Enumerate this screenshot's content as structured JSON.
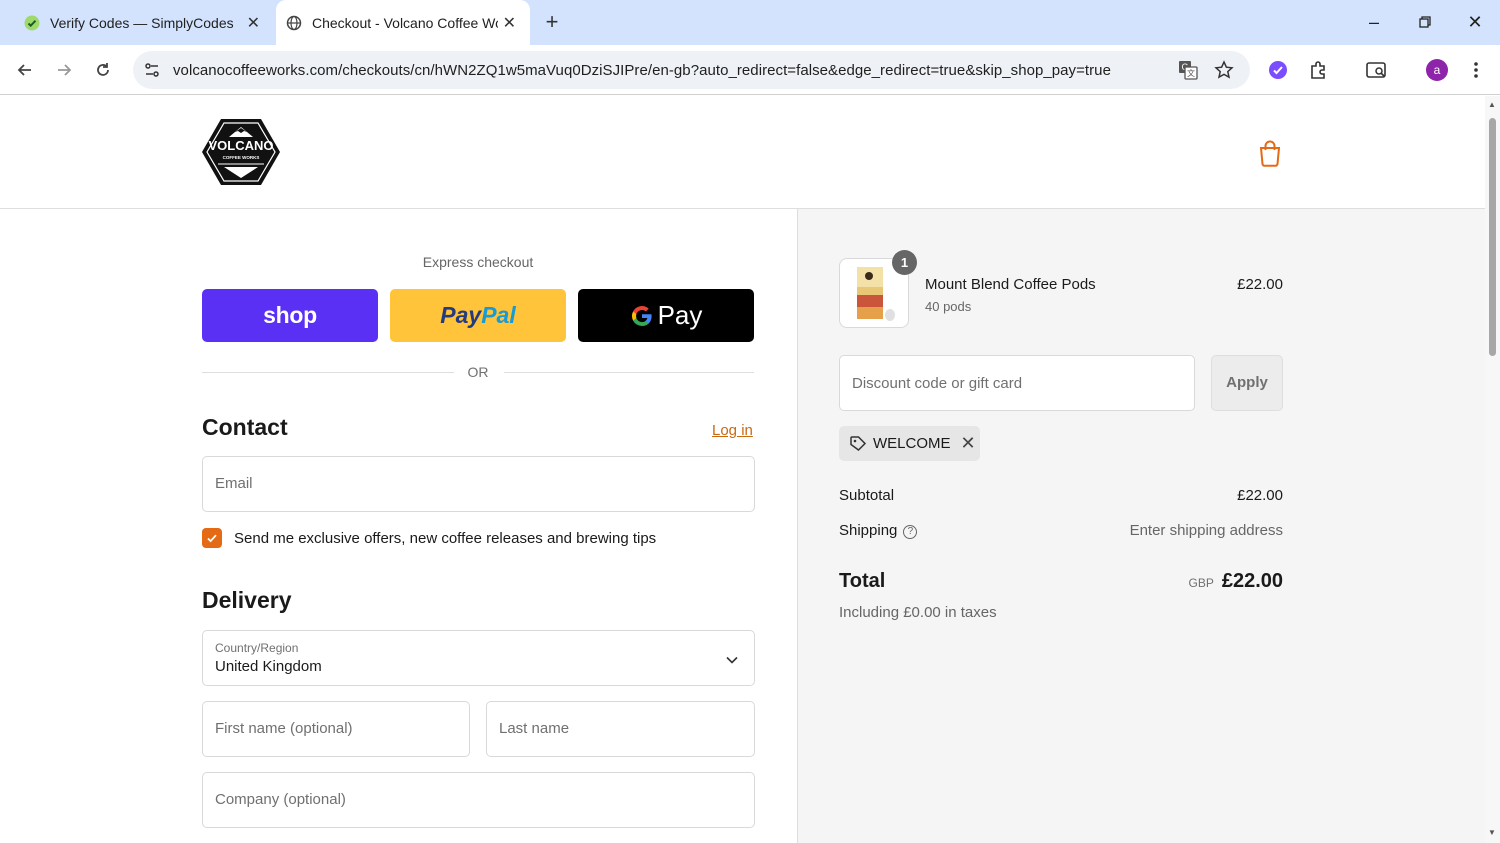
{
  "browser": {
    "tabs": [
      {
        "title": "Verify Codes — SimplyCodes",
        "favicon": "simplycodes-icon"
      },
      {
        "title": "Checkout - Volcano Coffee Wor",
        "favicon": "globe-icon",
        "active": true
      }
    ],
    "url": "volcanocoffeeworks.com/checkouts/cn/hWN2ZQ1w5maVuq0DziSJIPre/en-gb?auto_redirect=false&edge_redirect=true&skip_shop_pay=true",
    "profile_initial": "a"
  },
  "header": {
    "logo_text": "VOLCANO",
    "logo_subtext": "COFFEE WORKS"
  },
  "express": {
    "label": "Express checkout",
    "shop_label": "shop",
    "paypal_label_1": "Pay",
    "paypal_label_2": "Pal",
    "gpay_label": "Pay",
    "or_label": "OR"
  },
  "contact": {
    "heading": "Contact",
    "login_label": "Log in",
    "email_placeholder": "Email",
    "marketing_label": "Send me exclusive offers, new coffee releases and brewing tips",
    "marketing_checked": true
  },
  "delivery": {
    "heading": "Delivery",
    "country_label": "Country/Region",
    "country_value": "United Kingdom",
    "first_name_placeholder": "First name (optional)",
    "last_name_placeholder": "Last name",
    "company_placeholder": "Company (optional)"
  },
  "summary": {
    "item": {
      "quantity": "1",
      "name": "Mount Blend Coffee Pods",
      "variant": "40 pods",
      "price": "£22.00"
    },
    "discount_placeholder": "Discount code or gift card",
    "apply_label": "Apply",
    "applied_code": "WELCOME",
    "subtotal_label": "Subtotal",
    "subtotal_value": "£22.00",
    "shipping_label": "Shipping",
    "shipping_value": "Enter shipping address",
    "total_label": "Total",
    "total_currency": "GBP",
    "total_value": "£22.00",
    "taxes_note": "Including £0.00 in taxes"
  },
  "colors": {
    "shop_purple": "#5a31f4",
    "paypal_yellow": "#ffc439",
    "accent_orange": "#e56a16"
  }
}
